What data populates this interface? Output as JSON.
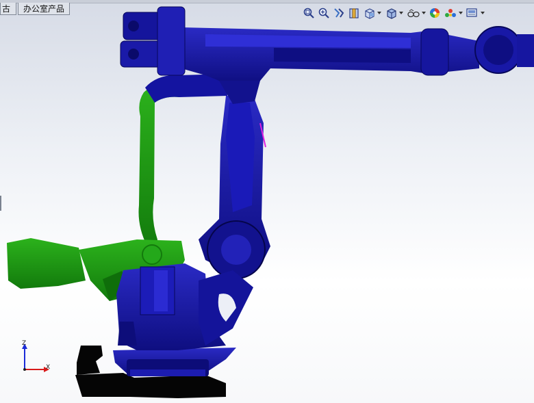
{
  "window": {
    "tabs": [
      {
        "label": "古"
      },
      {
        "label": "办公室产品"
      }
    ]
  },
  "heads_up_toolbar": {
    "items": [
      {
        "icon": "zoom-to-fit-icon",
        "dropdown": false
      },
      {
        "icon": "zoom-to-area-icon",
        "dropdown": false
      },
      {
        "icon": "previous-view-icon",
        "dropdown": false
      },
      {
        "icon": "section-view-icon",
        "dropdown": false
      },
      {
        "icon": "view-orientation-icon",
        "dropdown": true
      },
      {
        "icon": "display-style-icon",
        "dropdown": true
      },
      {
        "icon": "hide-show-items-icon",
        "dropdown": true
      },
      {
        "icon": "edit-appearance-icon",
        "dropdown": false
      },
      {
        "icon": "apply-scene-icon",
        "dropdown": true
      },
      {
        "icon": "view-settings-icon",
        "dropdown": true
      }
    ]
  },
  "model": {
    "colors": {
      "primary": "#1a1aa6",
      "primary_dark": "#0b0b6e",
      "selected": "#1f9a12",
      "selected_dark": "#137a0c",
      "base": "#050505",
      "highlight_edge": "#e020e0"
    }
  },
  "triad": {
    "z_label": "Z",
    "x_label": "X",
    "z_color": "#1a2bd8",
    "x_color": "#d81a1a"
  }
}
